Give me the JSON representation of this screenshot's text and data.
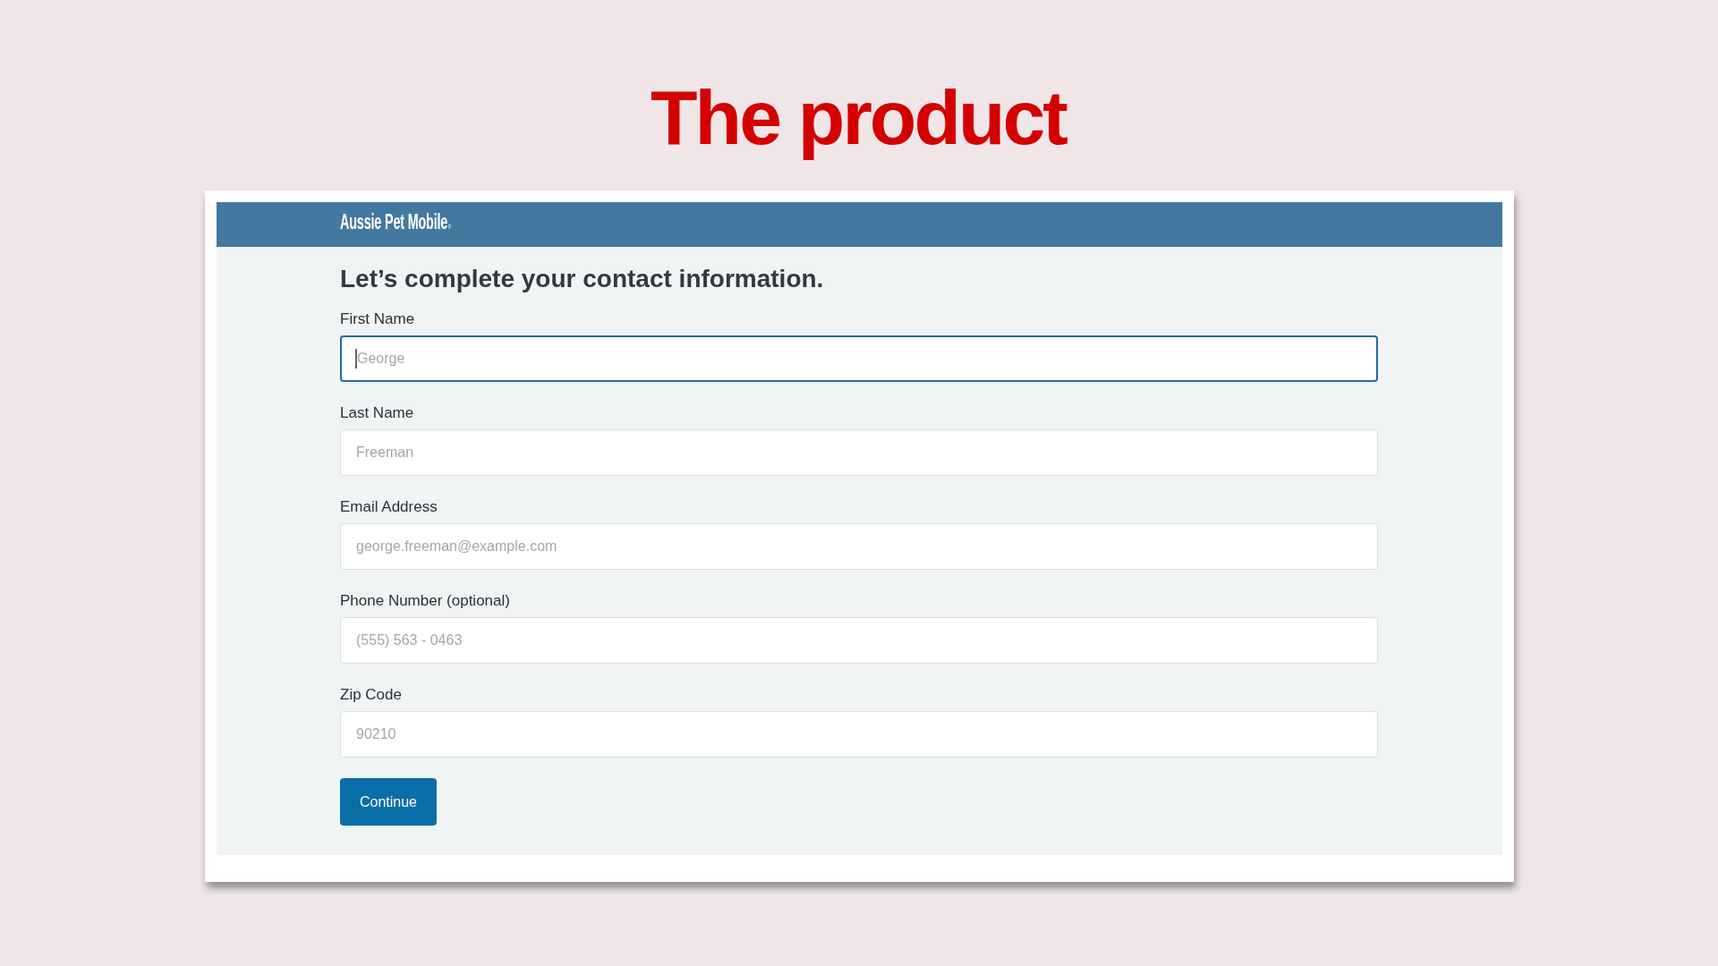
{
  "slide": {
    "title": "The product"
  },
  "app": {
    "header": {
      "logo": "Aussie Pet Mobile",
      "logo_mark": "®"
    },
    "heading": "Let’s complete your contact information.",
    "fields": [
      {
        "label": "First Name",
        "placeholder": "George",
        "focused": true
      },
      {
        "label": "Last Name",
        "placeholder": "Freeman",
        "focused": false
      },
      {
        "label": "Email Address",
        "placeholder": "george.freeman@example.com",
        "focused": false
      },
      {
        "label": "Phone Number (optional)",
        "placeholder": "(555) 563 - 0463",
        "focused": false
      },
      {
        "label": "Zip Code",
        "placeholder": "90210",
        "focused": false
      }
    ],
    "submit_button": "Continue"
  }
}
